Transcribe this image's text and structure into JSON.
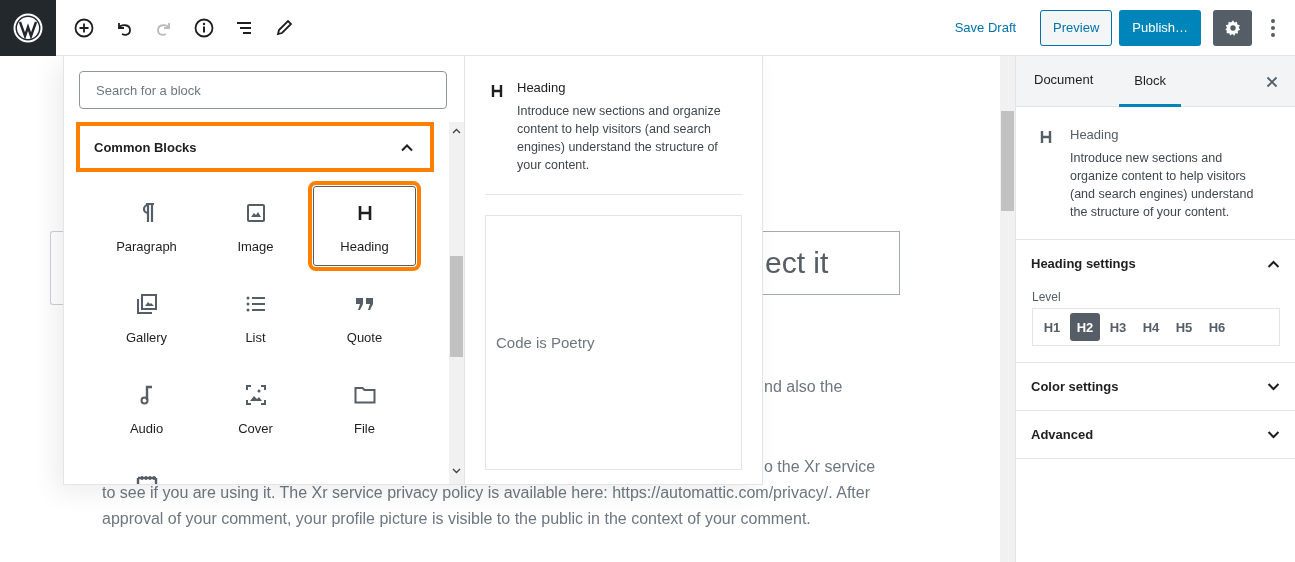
{
  "top_bar": {
    "save_draft": "Save Draft",
    "preview": "Preview",
    "publish": "Publish…"
  },
  "editor": {
    "heading_fragment": "ect it",
    "lines": [
      {
        "kind": "partial",
        "text": "nd also the"
      },
      {
        "kind": "partial",
        "text": "o the Xr service"
      },
      {
        "kind": "full",
        "text": "to see if you are using it. The Xr service privacy policy is available here: https://automattic.com/privacy/. After"
      },
      {
        "kind": "full",
        "text": "approval of your comment, your profile picture is visible to the public in the context of your comment."
      }
    ]
  },
  "inserter": {
    "search": {
      "placeholder": "Search for a block"
    },
    "category": {
      "label": "Common Blocks",
      "expanded": true
    },
    "blocks": [
      {
        "kind": "paragraph",
        "label": "Paragraph",
        "selected": false
      },
      {
        "kind": "image",
        "label": "Image",
        "selected": false
      },
      {
        "kind": "heading",
        "label": "Heading",
        "selected": true
      },
      {
        "kind": "gallery",
        "label": "Gallery",
        "selected": false
      },
      {
        "kind": "list",
        "label": "List",
        "selected": false
      },
      {
        "kind": "quote",
        "label": "Quote",
        "selected": false
      },
      {
        "kind": "audio",
        "label": "Audio",
        "selected": false
      },
      {
        "kind": "cover",
        "label": "Cover",
        "selected": false
      },
      {
        "kind": "file",
        "label": "File",
        "selected": false
      },
      {
        "kind": "video",
        "selected": false
      }
    ],
    "preview": {
      "title": "Heading",
      "description": "Introduce new sections and organize content to help visitors (and search engines) understand the structure of your content.",
      "sample": "Code is Poetry"
    }
  },
  "sidebar": {
    "tabs": [
      {
        "label": "Document",
        "selected": false
      },
      {
        "label": "Block",
        "selected": true
      }
    ],
    "block_card": {
      "title": "Heading",
      "description": "Introduce new sections and organize content to help visitors (and search engines) understand the structure of your content."
    },
    "panels": [
      {
        "title": "Heading settings",
        "expanded": true,
        "level_label": "Level",
        "levels": [
          {
            "label": "H1",
            "selected": false
          },
          {
            "label": "H2",
            "selected": true
          },
          {
            "label": "H3",
            "selected": false
          },
          {
            "label": "H4",
            "selected": false
          },
          {
            "label": "H5",
            "selected": false
          },
          {
            "label": "H6",
            "selected": false
          }
        ]
      },
      {
        "title": "Color settings",
        "expanded": false
      },
      {
        "title": "Advanced",
        "expanded": false
      }
    ]
  }
}
